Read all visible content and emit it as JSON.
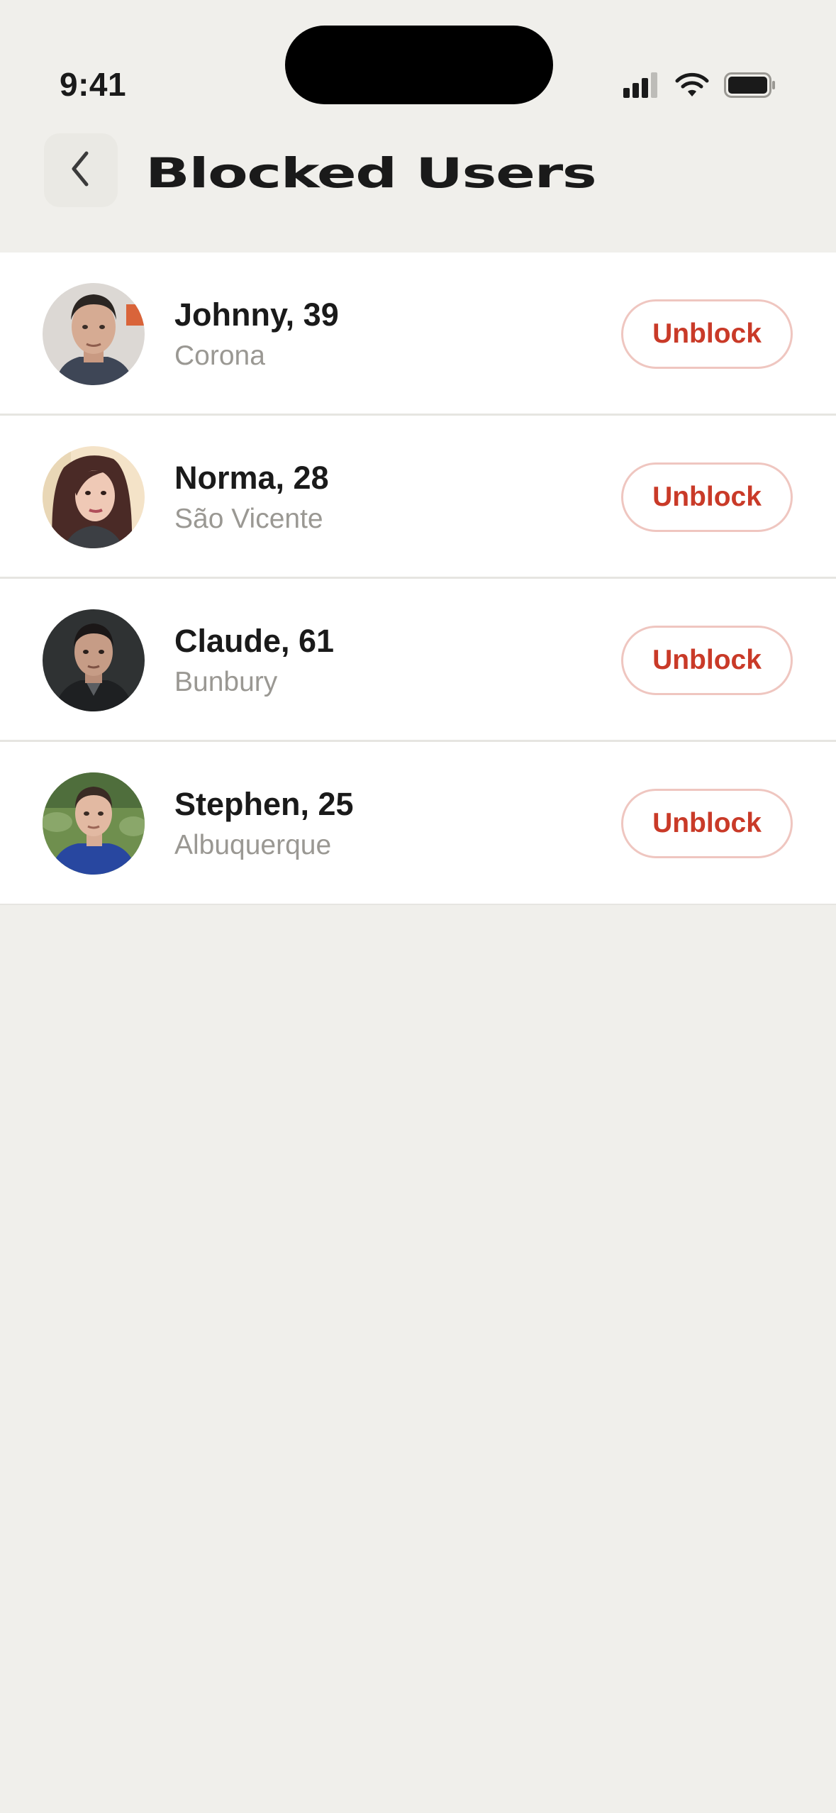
{
  "status_bar": {
    "time": "9:41"
  },
  "header": {
    "back_icon": "chevron-left-icon",
    "title": "Blocked Users"
  },
  "colors": {
    "background": "#f0efeb",
    "accent": "#c93a28",
    "button_border": "#efc6c0",
    "secondary_text": "#9a9893"
  },
  "users": [
    {
      "name": "Johnny, 39",
      "city": "Corona",
      "action": "Unblock"
    },
    {
      "name": "Norma, 28",
      "city": "São Vicente",
      "action": "Unblock"
    },
    {
      "name": "Claude, 61",
      "city": "Bunbury",
      "action": "Unblock"
    },
    {
      "name": "Stephen, 25",
      "city": "Albuquerque",
      "action": "Unblock"
    }
  ]
}
